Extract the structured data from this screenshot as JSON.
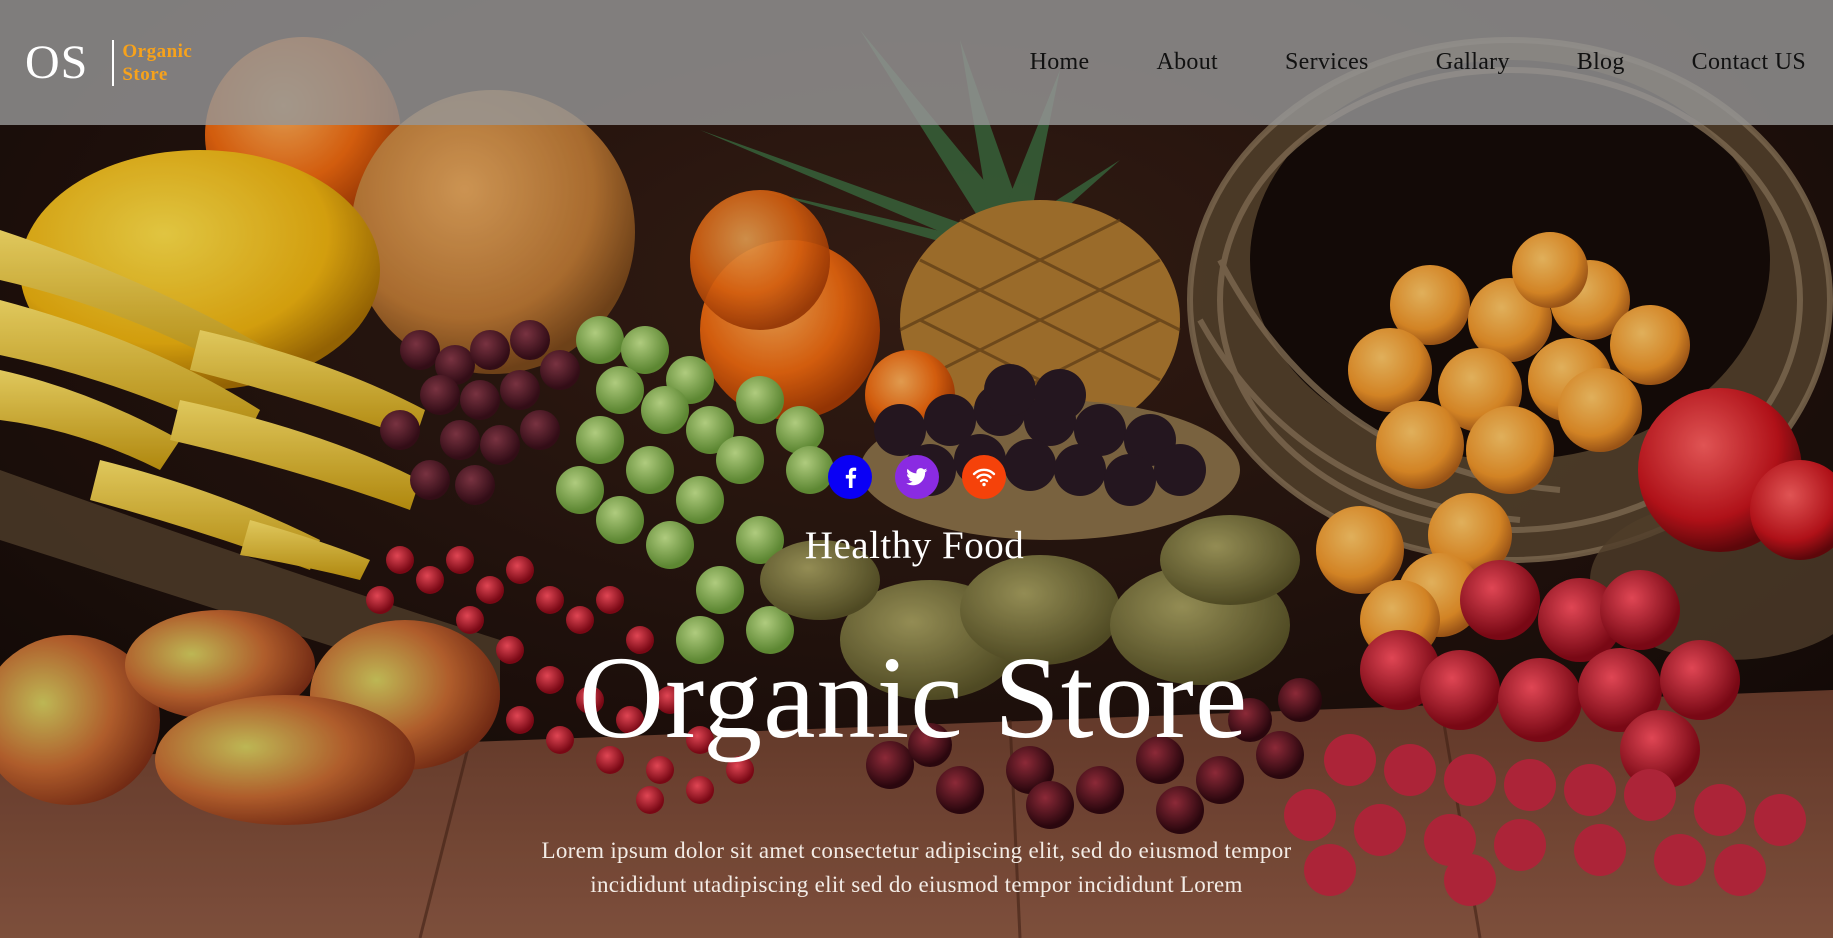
{
  "brand": {
    "initials": "OS",
    "name_line1": "Organic",
    "name_line2": "Store"
  },
  "nav": {
    "items": [
      {
        "label": "Home"
      },
      {
        "label": "About"
      },
      {
        "label": "Services"
      },
      {
        "label": "Gallary"
      },
      {
        "label": "Blog"
      },
      {
        "label": "Contact US"
      }
    ]
  },
  "social": [
    {
      "icon": "facebook-icon",
      "color": "#0a00f5"
    },
    {
      "icon": "twitter-icon",
      "color": "#8a2be2"
    },
    {
      "icon": "rss-icon",
      "color": "#f5420a"
    }
  ],
  "hero": {
    "subtitle": "Healthy Food",
    "title": "Organic Store",
    "desc_line1": "Lorem ipsum dolor sit amet consectetur adipiscing elit, sed do eiusmod tempor",
    "desc_line2": "incididunt utadipiscing elit sed do eiusmod tempor incididunt Lorem"
  },
  "colors": {
    "navbar_bg": "#969696",
    "brand_accent": "#f7a21b",
    "text_light": "#ffffff"
  }
}
